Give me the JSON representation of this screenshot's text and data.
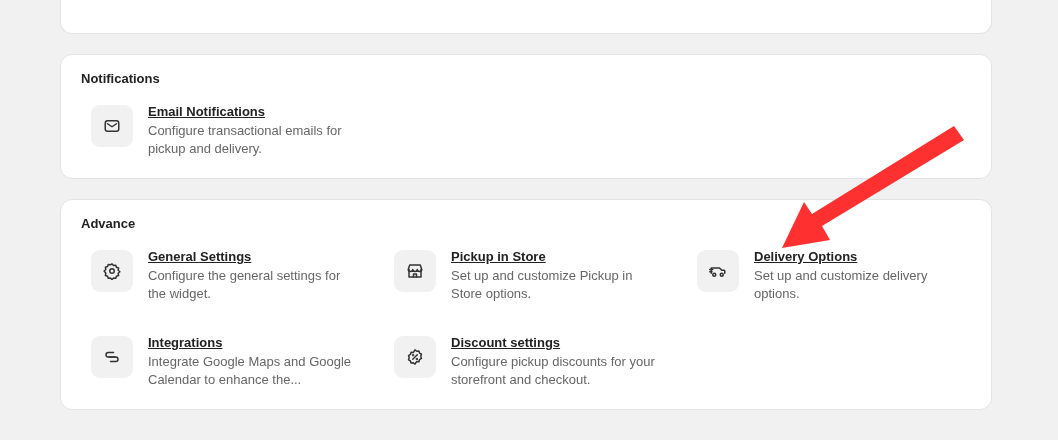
{
  "sections": [
    {
      "title": "Notifications",
      "items": [
        {
          "kind": "mail",
          "title": "Email Notifications",
          "description": "Configure transactional emails for pickup and delivery."
        }
      ]
    },
    {
      "title": "Advance",
      "items": [
        {
          "kind": "gear",
          "title": "General Settings",
          "description": "Configure the general settings for the widget."
        },
        {
          "kind": "store",
          "title": "Pickup in Store",
          "description": "Set up and customize Pickup in Store options."
        },
        {
          "kind": "truck",
          "title": "Delivery Options",
          "description": "Set up and customize delivery options."
        },
        {
          "kind": "link",
          "title": "Integrations",
          "description": "Integrate Google Maps and Google Calendar to enhance the..."
        },
        {
          "kind": "discount",
          "title": "Discount settings",
          "description": "Configure pickup discounts for your storefront and checkout."
        }
      ]
    }
  ]
}
